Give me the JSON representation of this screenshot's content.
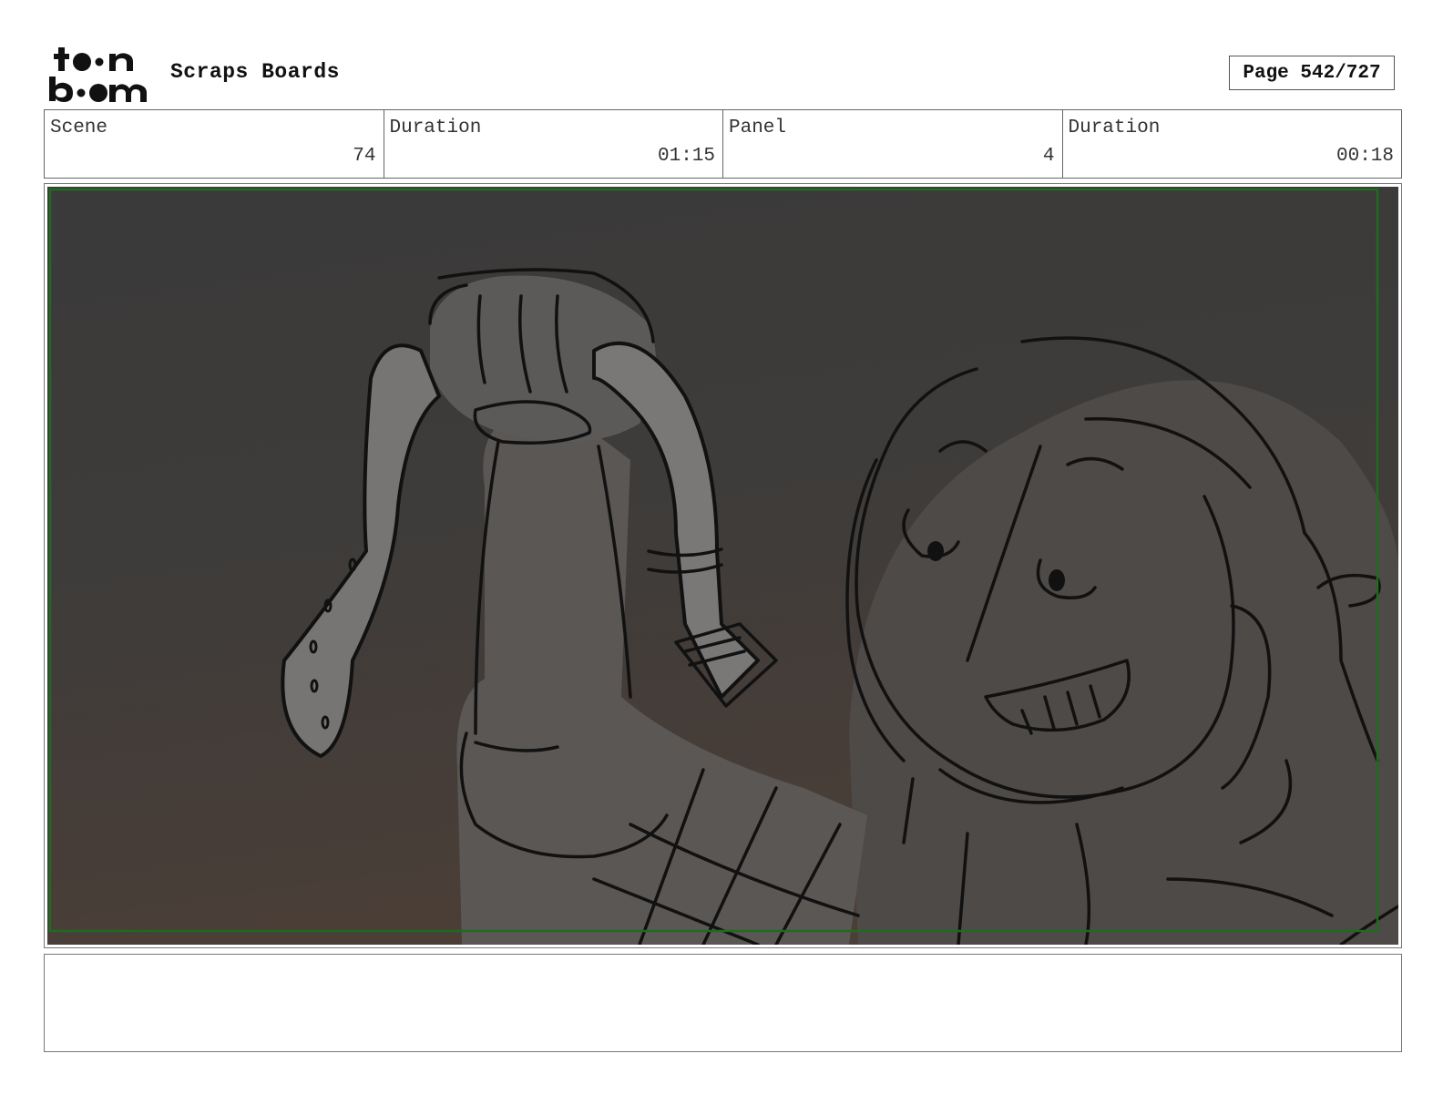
{
  "header": {
    "logo_text": "toon boom",
    "project_title": "Scraps Boards",
    "page_label": "Page 542/727"
  },
  "info": {
    "scene_label": "Scene",
    "scene_value": "74",
    "scene_duration_label": "Duration",
    "scene_duration_value": "01:15",
    "panel_label": "Panel",
    "panel_value": "4",
    "panel_duration_label": "Duration",
    "panel_duration_value": "00:18"
  },
  "panel": {
    "description": "",
    "colors": {
      "background_top": "#3a3a3a",
      "background_bottom": "#4a3e38",
      "figure_fill": "#5e5e5e",
      "strap_fill": "#7a7a7a",
      "line": "#111111",
      "safe_area_border": "#1f6b1f"
    }
  },
  "notes": {
    "text": ""
  }
}
